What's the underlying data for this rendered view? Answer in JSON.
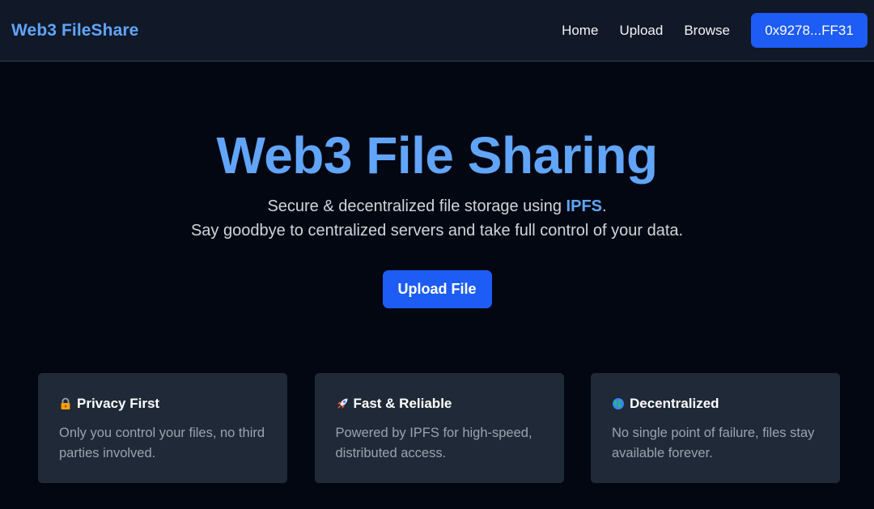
{
  "navbar": {
    "brand": "Web3 FileShare",
    "links": [
      {
        "label": "Home"
      },
      {
        "label": "Upload"
      },
      {
        "label": "Browse"
      }
    ],
    "wallet_label": "0x9278...FF31"
  },
  "hero": {
    "title": "Web3 File Sharing",
    "subtitle_line1_prefix": "Secure & decentralized file storage using ",
    "subtitle_line1_highlight": "IPFS",
    "subtitle_line1_suffix": ".",
    "subtitle_line2": "Say goodbye to centralized servers and take full control of your data.",
    "upload_label": "Upload File"
  },
  "features": [
    {
      "icon": "lock-icon",
      "title": "Privacy First",
      "description": "Only you control your files, no third parties involved."
    },
    {
      "icon": "rocket-icon",
      "title": "Fast & Reliable",
      "description": "Powered by IPFS for high-speed, distributed access."
    },
    {
      "icon": "globe-icon",
      "title": "Decentralized",
      "description": "No single point of failure, files stay available forever."
    }
  ],
  "colors": {
    "background": "#030712",
    "navbar": "#111827",
    "accent": "#60a5fa",
    "button": "#1d5cf5",
    "card": "#1f2937"
  }
}
